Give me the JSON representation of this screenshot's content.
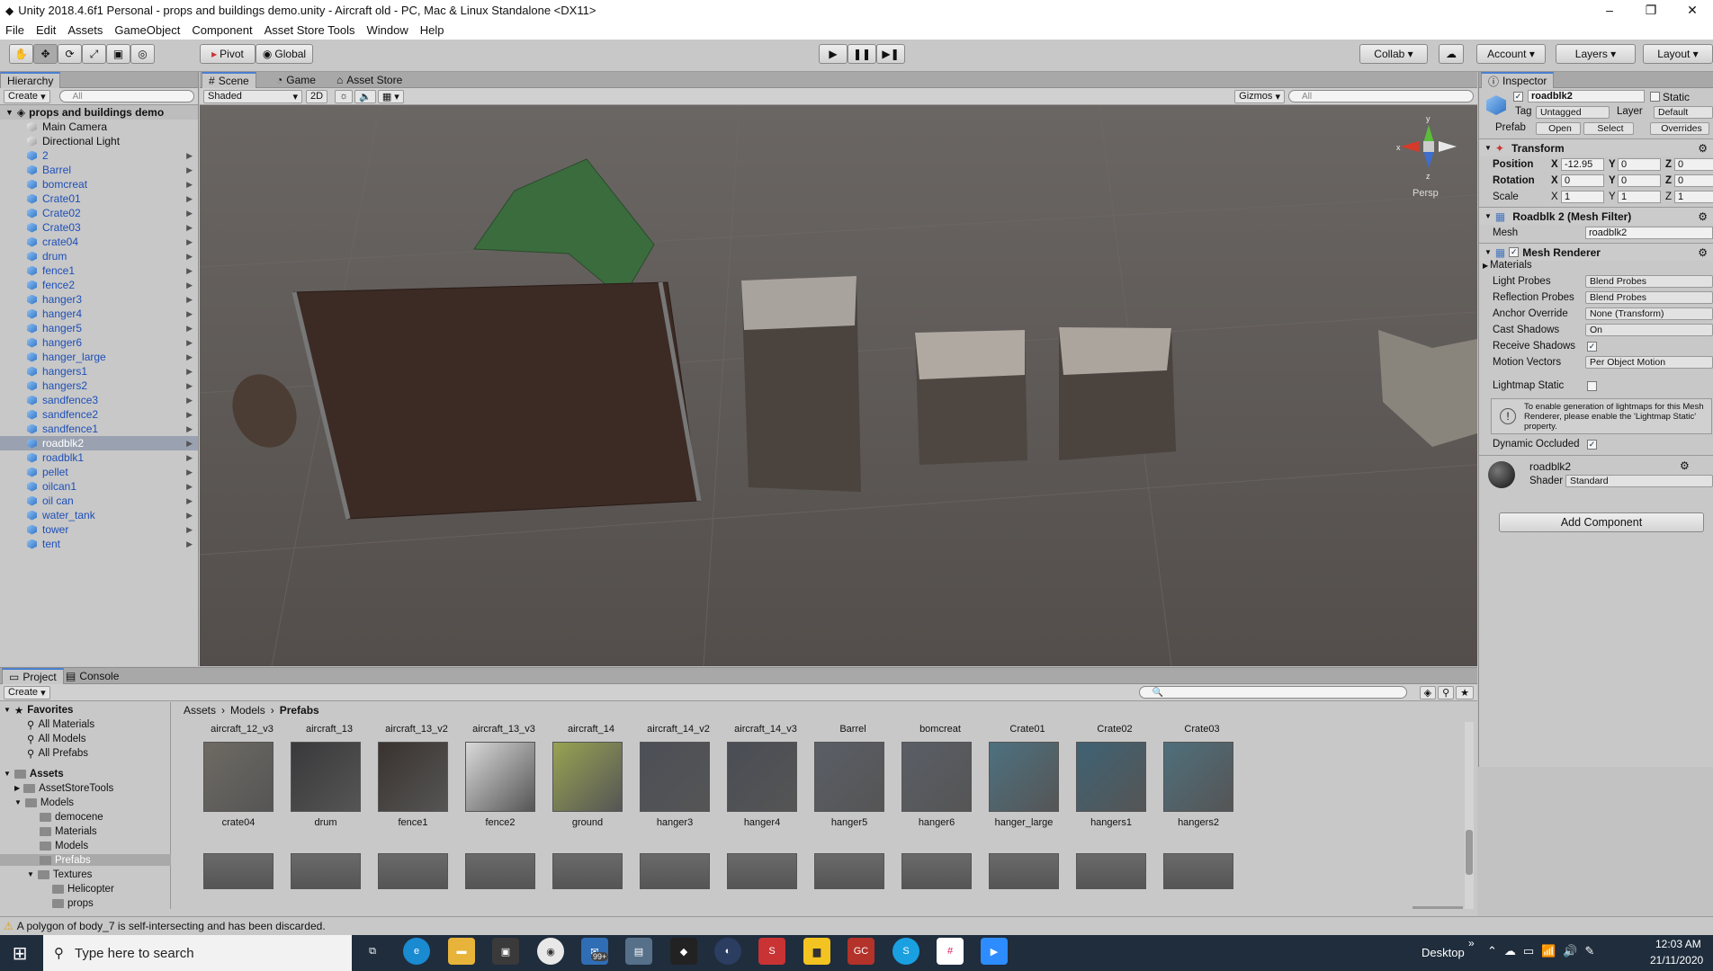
{
  "window": {
    "title": "Unity 2018.4.6f1 Personal - props and buildings demo.unity - Aircraft old - PC, Mac & Linux Standalone <DX11>",
    "controls": [
      "–",
      "❐",
      "✕"
    ]
  },
  "menu": [
    "File",
    "Edit",
    "Assets",
    "GameObject",
    "Component",
    "Asset Store Tools",
    "Window",
    "Help"
  ],
  "toolbar": {
    "pivot": "Pivot",
    "global": "Global",
    "collab": "Collab",
    "account": "Account",
    "layers": "Layers",
    "layout": "Layout"
  },
  "hierarchy": {
    "tab": "Hierarchy",
    "create": "Create",
    "search_placeholder": "All",
    "scene": "props and buildings demo",
    "items": [
      {
        "label": "Main Camera",
        "type": "gray",
        "arrow": false
      },
      {
        "label": "Directional Light",
        "type": "gray",
        "arrow": false
      },
      {
        "label": "2",
        "type": "blue",
        "arrow": true
      },
      {
        "label": "Barrel",
        "type": "blue",
        "arrow": true
      },
      {
        "label": "bomcreat",
        "type": "blue",
        "arrow": true
      },
      {
        "label": "Crate01",
        "type": "blue",
        "arrow": true
      },
      {
        "label": "Crate02",
        "type": "blue",
        "arrow": true
      },
      {
        "label": "Crate03",
        "type": "blue",
        "arrow": true
      },
      {
        "label": "crate04",
        "type": "blue",
        "arrow": true
      },
      {
        "label": "drum",
        "type": "blue",
        "arrow": true
      },
      {
        "label": "fence1",
        "type": "blue",
        "arrow": true
      },
      {
        "label": "fence2",
        "type": "blue",
        "arrow": true
      },
      {
        "label": "hanger3",
        "type": "blue",
        "arrow": true
      },
      {
        "label": "hanger4",
        "type": "blue",
        "arrow": true
      },
      {
        "label": "hanger5",
        "type": "blue",
        "arrow": true
      },
      {
        "label": "hanger6",
        "type": "blue",
        "arrow": true
      },
      {
        "label": "hanger_large",
        "type": "blue",
        "arrow": true
      },
      {
        "label": "hangers1",
        "type": "blue",
        "arrow": true
      },
      {
        "label": "hangers2",
        "type": "blue",
        "arrow": true
      },
      {
        "label": "sandfence3",
        "type": "blue",
        "arrow": true
      },
      {
        "label": "sandfence2",
        "type": "blue",
        "arrow": true
      },
      {
        "label": "sandfence1",
        "type": "blue",
        "arrow": true
      },
      {
        "label": "roadblk2",
        "type": "blue",
        "arrow": true,
        "selected": true
      },
      {
        "label": "roadblk1",
        "type": "blue",
        "arrow": true
      },
      {
        "label": "pellet",
        "type": "blue",
        "arrow": true
      },
      {
        "label": "oilcan1",
        "type": "blue",
        "arrow": true
      },
      {
        "label": "oil can",
        "type": "blue",
        "arrow": true
      },
      {
        "label": "water_tank",
        "type": "blue",
        "arrow": true
      },
      {
        "label": "tower",
        "type": "blue",
        "arrow": true
      },
      {
        "label": "tent",
        "type": "blue",
        "arrow": true
      }
    ]
  },
  "scene": {
    "tabs": [
      "Scene",
      "Game",
      "Asset Store"
    ],
    "shading": "Shaded",
    "mode2d": "2D",
    "gizmos": "Gizmos",
    "search_placeholder": "All",
    "persp": "Persp"
  },
  "inspector": {
    "tab": "Inspector",
    "object_name": "roadblk2",
    "static": "Static",
    "tag_label": "Tag",
    "tag": "Untagged",
    "layer_label": "Layer",
    "layer": "Default",
    "prefab_label": "Prefab",
    "open": "Open",
    "select": "Select",
    "overrides": "Overrides",
    "transform": {
      "title": "Transform",
      "position": "Position",
      "rotation": "Rotation",
      "scale": "Scale",
      "pos": [
        "-12.95",
        "0",
        "0"
      ],
      "rot": [
        "0",
        "0",
        "0"
      ],
      "scl": [
        "1",
        "1",
        "1"
      ]
    },
    "mesh_filter": {
      "title": "Roadblk 2 (Mesh Filter)",
      "mesh_label": "Mesh",
      "mesh": "roadblk2"
    },
    "mesh_renderer": {
      "title": "Mesh Renderer",
      "materials": "Materials",
      "rows": [
        {
          "label": "Light Probes",
          "value": "Blend Probes"
        },
        {
          "label": "Reflection Probes",
          "value": "Blend Probes"
        },
        {
          "label": "Anchor Override",
          "value": "None (Transform)"
        },
        {
          "label": "Cast Shadows",
          "value": "On"
        },
        {
          "label": "Receive Shadows",
          "value": "✓"
        },
        {
          "label": "Motion Vectors",
          "value": "Per Object Motion"
        }
      ],
      "lightmap_static": "Lightmap Static",
      "info": "To enable generation of lightmaps for this Mesh Renderer, please enable the 'Lightmap Static' property.",
      "dynamic_occluded": "Dynamic Occluded"
    },
    "material": {
      "name": "roadblk2",
      "shader_label": "Shader",
      "shader": "Standard"
    },
    "add_component": "Add Component"
  },
  "project": {
    "tabs": [
      "Project",
      "Console"
    ],
    "create": "Create",
    "breadcrumb": [
      "Assets",
      "Models",
      "Prefabs"
    ],
    "favorites": {
      "title": "Favorites",
      "items": [
        "All Materials",
        "All Models",
        "All Prefabs"
      ]
    },
    "assets_title": "Assets",
    "tree": [
      "AssetStoreTools",
      "Models",
      "democene",
      "Materials",
      "Models",
      "Prefabs",
      "Textures",
      "Helicopter",
      "props"
    ],
    "top_labels": [
      "aircraft_12_v3",
      "aircraft_13",
      "aircraft_13_v2",
      "aircraft_13_v3",
      "aircraft_14",
      "aircraft_14_v2",
      "aircraft_14_v3",
      "Barrel",
      "bomcreat",
      "Crate01",
      "Crate02",
      "Crate03"
    ],
    "row_labels": [
      "crate04",
      "drum",
      "fence1",
      "fence2",
      "ground",
      "hanger3",
      "hanger4",
      "hanger5",
      "hanger6",
      "hanger_large",
      "hangers1",
      "hangers2"
    ]
  },
  "statusbar": {
    "message": "A polygon of body_7 is self-intersecting and has been discarded."
  },
  "taskbar": {
    "search": "Type here to search",
    "desktop": "Desktop",
    "time": "12:03 AM",
    "date": "21/11/2020",
    "badge": "99+",
    "gc": "GC"
  }
}
